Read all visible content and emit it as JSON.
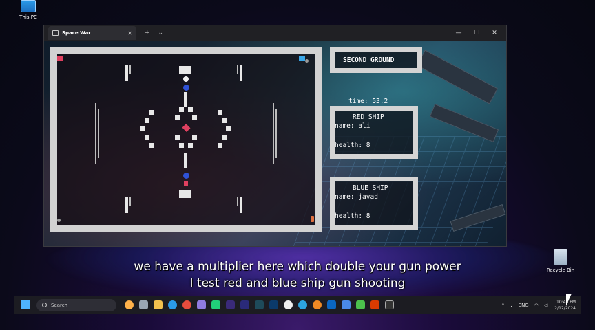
{
  "desktop": {
    "this_pc_label": "This PC",
    "recycle_bin_label": "Recycle Bin"
  },
  "window": {
    "tab_title": "Space War",
    "tab_close": "✕",
    "new_tab": "+",
    "tab_menu": "⌄",
    "minimize": "—",
    "maximize": "☐",
    "close": "✕"
  },
  "game": {
    "ground_label": "SECOND GROUND",
    "time_text": "time: 53.2",
    "red_ship": {
      "title": "RED SHIP",
      "name_text": "name: ali",
      "health_text": "health: 8"
    },
    "blue_ship": {
      "title": "BLUE SHIP",
      "name_text": "name: javad",
      "health_text": "health: 8"
    },
    "colors": {
      "red_ship": "#e04060",
      "blue_ship": "#3aa7e8",
      "panel_border": "#d4d4d4",
      "blue_bullet": "#2f52d6"
    }
  },
  "subtitles": {
    "line1": "we have a multiplier here which double your gun power",
    "line2": "I test red and blue ship gun shooting"
  },
  "taskbar": {
    "search_placeholder": "Search",
    "lang": "ENG",
    "time": "10:43 PM",
    "date": "2/12/2024",
    "apps": [
      "browser",
      "files",
      "edge",
      "chrome",
      "github",
      "pycharm",
      "premiere",
      "after-effects",
      "audition",
      "photoshop",
      "obs",
      "telegram",
      "vlc",
      "linkedin",
      "teams",
      "terminal",
      "powerpoint",
      "cmd"
    ]
  }
}
